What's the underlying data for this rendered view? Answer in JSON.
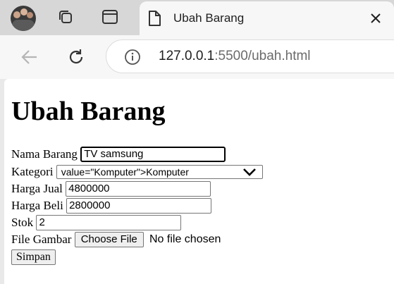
{
  "browser": {
    "tab": {
      "title": "Ubah Barang"
    },
    "address": {
      "host": "127.0.0.1",
      "rest": ":5500/ubah.html"
    },
    "icons": {
      "avatar": "profile-avatar",
      "collections": "collections-icon",
      "tab_actions": "tab-actions-icon",
      "page": "page-icon",
      "close": "close-icon",
      "back": "back-arrow-icon",
      "reload": "reload-icon",
      "info": "info-icon"
    }
  },
  "form": {
    "heading": "Ubah Barang",
    "nama_label": "Nama Barang",
    "nama_value": "TV samsung",
    "kategori_label": "Kategori",
    "kategori_value": "value=\"Komputer\">Komputer",
    "harga_jual_label": "Harga Jual",
    "harga_jual_value": "4800000",
    "harga_beli_label": "Harga Beli",
    "harga_beli_value": "2800000",
    "stok_label": "Stok",
    "stok_value": "2",
    "file_label": "File Gambar",
    "file_button": "Choose File",
    "file_status": "No file chosen",
    "submit": "Simpan"
  }
}
